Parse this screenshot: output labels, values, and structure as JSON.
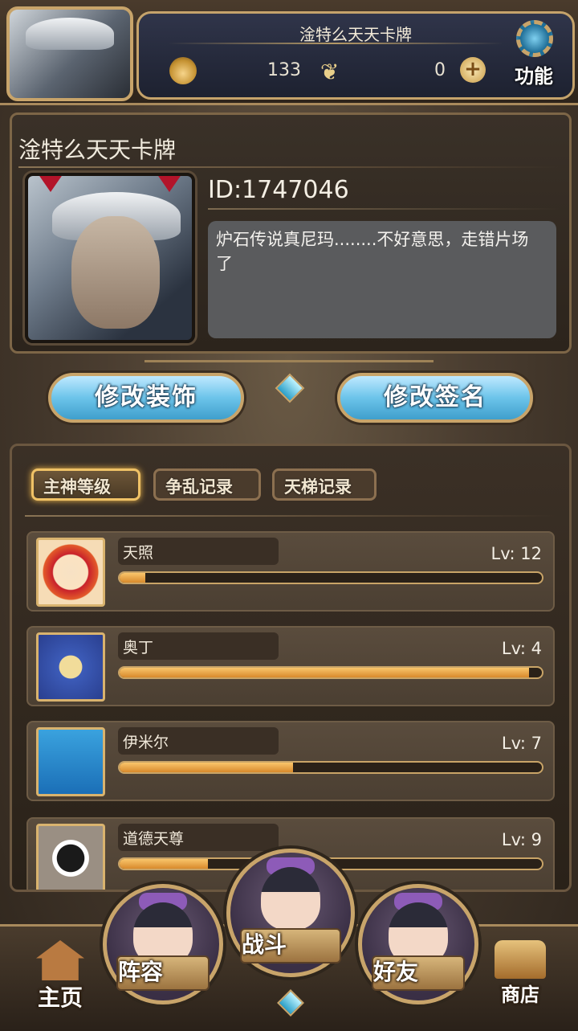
{
  "header": {
    "player_name": "淦特么天天卡牌",
    "gold": "133",
    "gems": "0",
    "function_label": "功能"
  },
  "profile": {
    "name": "淦特么天天卡牌",
    "id": "ID:1747046",
    "signature": "炉石传说真尼玛........不好意思，走错片场了"
  },
  "actions": {
    "edit_decoration": "修改装饰",
    "edit_signature": "修改签名"
  },
  "tabs": [
    {
      "label": "主神等级",
      "active": true
    },
    {
      "label": "争乱记录",
      "active": false
    },
    {
      "label": "天梯记录",
      "active": false
    }
  ],
  "gods": [
    {
      "name": "天照",
      "level": "Lv: 12",
      "progress": 0.06,
      "icon": "sun-icon"
    },
    {
      "name": "奥丁",
      "level": "Lv: 4",
      "progress": 0.97,
      "icon": "odin-wings-icon"
    },
    {
      "name": "伊米尔",
      "level": "Lv: 7",
      "progress": 0.41,
      "icon": "ymir-ice-icon"
    },
    {
      "name": "道德天尊",
      "level": "Lv: 9",
      "progress": 0.21,
      "icon": "yin-yang-icon"
    }
  ],
  "nav": {
    "home": "主页",
    "team": "阵容",
    "battle": "战斗",
    "friends": "好友",
    "shop": "商店"
  },
  "colors": {
    "accent_gold": "#c8a46a",
    "button_blue": "#6cc4ea",
    "xp_orange": "#e89a36"
  }
}
